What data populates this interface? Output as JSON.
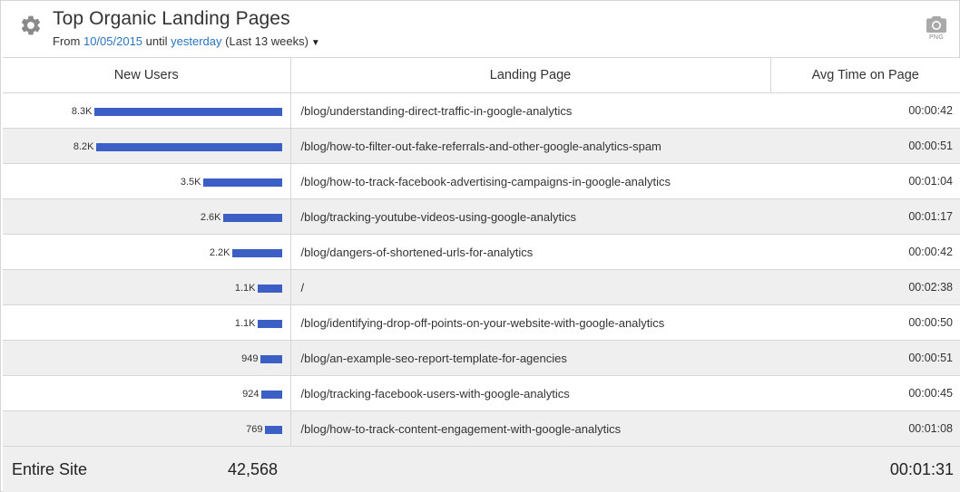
{
  "header": {
    "title": "Top Organic Landing Pages",
    "from_label": "From",
    "from_date": "10/05/2015",
    "until_label": "until",
    "until_date": "yesterday",
    "range_note": "(Last 13 weeks)",
    "caret": "▼",
    "export_label": "PNG"
  },
  "table": {
    "columns": [
      "New Users",
      "Landing Page",
      "Avg Time on Page"
    ],
    "rows": [
      {
        "users_label": "8.3K",
        "users": 8300,
        "page": "/blog/understanding-direct-traffic-in-google-analytics",
        "time": "00:00:42"
      },
      {
        "users_label": "8.2K",
        "users": 8200,
        "page": "/blog/how-to-filter-out-fake-referrals-and-other-google-analytics-spam",
        "time": "00:00:51"
      },
      {
        "users_label": "3.5K",
        "users": 3500,
        "page": "/blog/how-to-track-facebook-advertising-campaigns-in-google-analytics",
        "time": "00:01:04"
      },
      {
        "users_label": "2.6K",
        "users": 2600,
        "page": "/blog/tracking-youtube-videos-using-google-analytics",
        "time": "00:01:17"
      },
      {
        "users_label": "2.2K",
        "users": 2200,
        "page": "/blog/dangers-of-shortened-urls-for-analytics",
        "time": "00:00:42"
      },
      {
        "users_label": "1.1K",
        "users": 1100,
        "page": "/",
        "time": "00:02:38"
      },
      {
        "users_label": "1.1K",
        "users": 1100,
        "page": "/blog/identifying-drop-off-points-on-your-website-with-google-analytics",
        "time": "00:00:50"
      },
      {
        "users_label": "949",
        "users": 949,
        "page": "/blog/an-example-seo-report-template-for-agencies",
        "time": "00:00:51"
      },
      {
        "users_label": "924",
        "users": 924,
        "page": "/blog/tracking-facebook-users-with-google-analytics",
        "time": "00:00:45"
      },
      {
        "users_label": "769",
        "users": 769,
        "page": "/blog/how-to-track-content-engagement-with-google-analytics",
        "time": "00:01:08"
      }
    ],
    "total": {
      "label": "Entire Site",
      "users": "42,568",
      "time": "00:01:31"
    }
  },
  "colors": {
    "bar": "#3b5fc4",
    "link": "#2a73c2",
    "stripe": "#efefef"
  },
  "icons": {
    "settings": "gear-icon",
    "export": "camera-icon"
  }
}
